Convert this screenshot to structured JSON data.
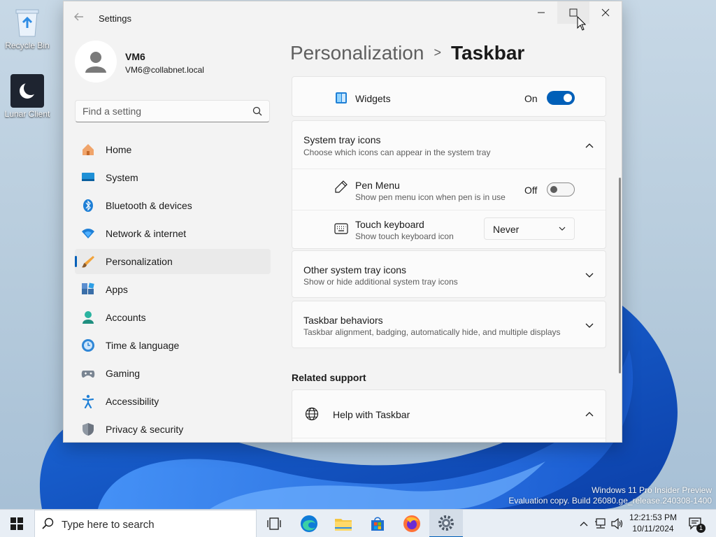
{
  "desktop": {
    "icons": [
      {
        "label": "Recycle Bin",
        "icon": "recycle-bin-icon"
      },
      {
        "label": "Lunar Client",
        "icon": "lunar-client-icon"
      }
    ],
    "watermark": {
      "line1": "Windows 11 Pro Insider Preview",
      "line2": "Evaluation copy. Build 26080.ge_release.240308-1400"
    }
  },
  "window": {
    "title": "Settings",
    "controls": {
      "minimize": "minimize-icon",
      "maximize": "maximize-icon",
      "close": "close-icon"
    }
  },
  "profile": {
    "name": "VM6",
    "email": "VM6@collabnet.local"
  },
  "search": {
    "placeholder": "Find a setting"
  },
  "nav": {
    "items": [
      {
        "label": "Home",
        "icon": "home-icon"
      },
      {
        "label": "System",
        "icon": "system-icon"
      },
      {
        "label": "Bluetooth & devices",
        "icon": "bluetooth-icon"
      },
      {
        "label": "Network & internet",
        "icon": "network-icon"
      },
      {
        "label": "Personalization",
        "icon": "personalization-icon",
        "active": true
      },
      {
        "label": "Apps",
        "icon": "apps-icon"
      },
      {
        "label": "Accounts",
        "icon": "accounts-icon"
      },
      {
        "label": "Time & language",
        "icon": "time-language-icon"
      },
      {
        "label": "Gaming",
        "icon": "gaming-icon"
      },
      {
        "label": "Accessibility",
        "icon": "accessibility-icon"
      },
      {
        "label": "Privacy & security",
        "icon": "privacy-icon"
      }
    ]
  },
  "breadcrumb": {
    "parent": "Personalization",
    "separator": ">",
    "current": "Taskbar"
  },
  "widgets": {
    "label": "Widgets",
    "state": "On",
    "toggle_on": true
  },
  "system_tray": {
    "title": "System tray icons",
    "subtitle": "Choose which icons can appear in the system tray",
    "expanded": true,
    "pen_menu": {
      "title": "Pen Menu",
      "subtitle": "Show pen menu icon when pen is in use",
      "state": "Off",
      "toggle_on": false
    },
    "touch_keyboard": {
      "title": "Touch keyboard",
      "subtitle": "Show touch keyboard icon",
      "value": "Never"
    }
  },
  "other_tray": {
    "title": "Other system tray icons",
    "subtitle": "Show or hide additional system tray icons"
  },
  "behaviors": {
    "title": "Taskbar behaviors",
    "subtitle": "Taskbar alignment, badging, automatically hide, and multiple displays"
  },
  "related": {
    "heading": "Related support",
    "help_title": "Help with Taskbar"
  },
  "taskbar": {
    "search_placeholder": "Type here to search",
    "apps": [
      "task-view-icon",
      "edge-icon",
      "file-explorer-icon",
      "store-icon",
      "firefox-icon",
      "settings-icon"
    ],
    "clock": {
      "time": "12:21:53 PM",
      "date": "10/11/2024"
    },
    "notification_count": "1"
  },
  "colors": {
    "accent": "#005fb8",
    "window_bg": "#f3f3f3",
    "card_bg": "#fbfbfb"
  }
}
